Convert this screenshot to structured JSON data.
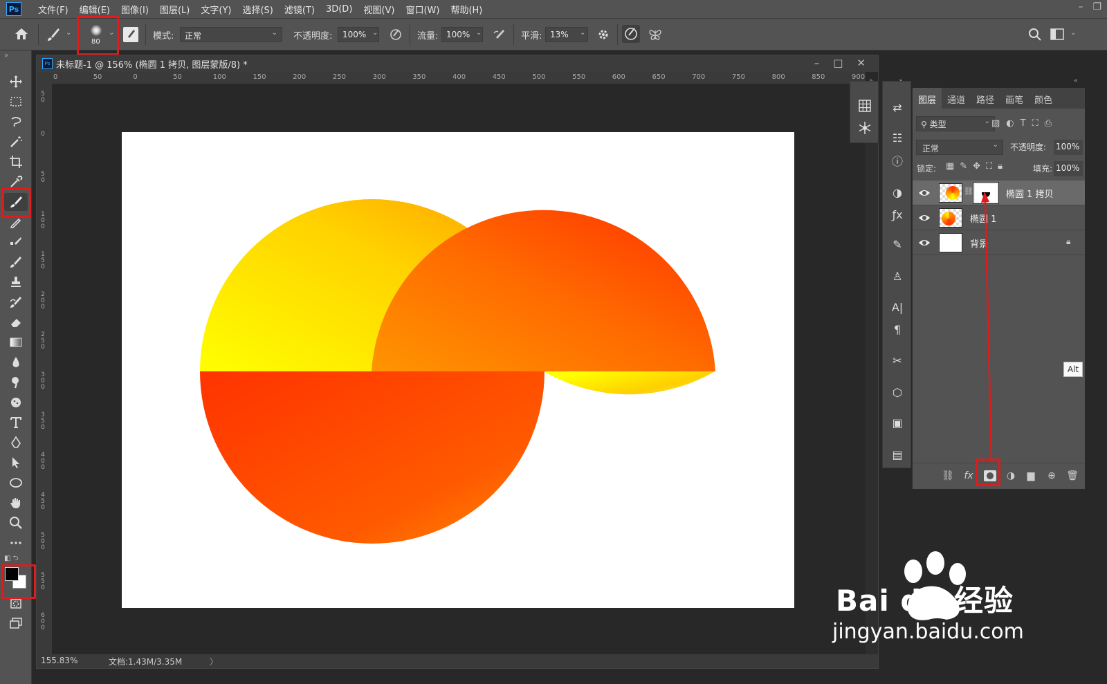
{
  "menubar": {
    "logo": "Ps",
    "items": [
      "文件(F)",
      "编辑(E)",
      "图像(I)",
      "图层(L)",
      "文字(Y)",
      "选择(S)",
      "滤镜(T)",
      "3D(D)",
      "视图(V)",
      "窗口(W)",
      "帮助(H)"
    ]
  },
  "options": {
    "brush_size": "80",
    "mode_label": "模式:",
    "mode_value": "正常",
    "opacity_label": "不透明度:",
    "opacity_value": "100%",
    "flow_label": "流量:",
    "flow_value": "100%",
    "smooth_label": "平滑:",
    "smooth_value": "13%"
  },
  "document": {
    "tab_title": "未标题-1 @ 156% (椭圆 1 拷贝, 图层蒙版/8) *",
    "zoom": "155.83%",
    "doc_info": "文档:1.43M/3.35M",
    "ruler_h": [
      "0",
      "50",
      "0",
      "50",
      "100",
      "150",
      "200",
      "250",
      "300",
      "350",
      "400",
      "450",
      "500",
      "550",
      "600",
      "650",
      "700",
      "750",
      "800",
      "850",
      "900"
    ],
    "ruler_v": [
      "5 0",
      "0",
      "5 0",
      "1 0 0",
      "1 5 0",
      "2 0 0",
      "2 5 0",
      "3 0 0",
      "3 5 0",
      "4 0 0",
      "4 5 0",
      "5 0 0",
      "5 5 0",
      "6 0 0"
    ]
  },
  "layers_panel": {
    "tabs": [
      "图层",
      "通道",
      "路径",
      "画笔",
      "颜色"
    ],
    "filter_label": "类型",
    "blend_mode": "正常",
    "opacity_label": "不透明度:",
    "opacity_value": "100%",
    "lock_label": "锁定:",
    "fill_label": "填充:",
    "fill_value": "100%",
    "layers": [
      {
        "name": "椭圆 1 拷贝",
        "selected": true
      },
      {
        "name": "椭圆 1",
        "selected": false
      },
      {
        "name": "背景",
        "selected": false
      }
    ]
  },
  "alt_badge": "Alt",
  "watermark": {
    "brand": "Bai du 经验",
    "url": "jingyan.baidu.com"
  },
  "colors": {
    "highlight": "#e21a1a",
    "yellow": "#ffff00",
    "orange_red": "#ff3300"
  }
}
